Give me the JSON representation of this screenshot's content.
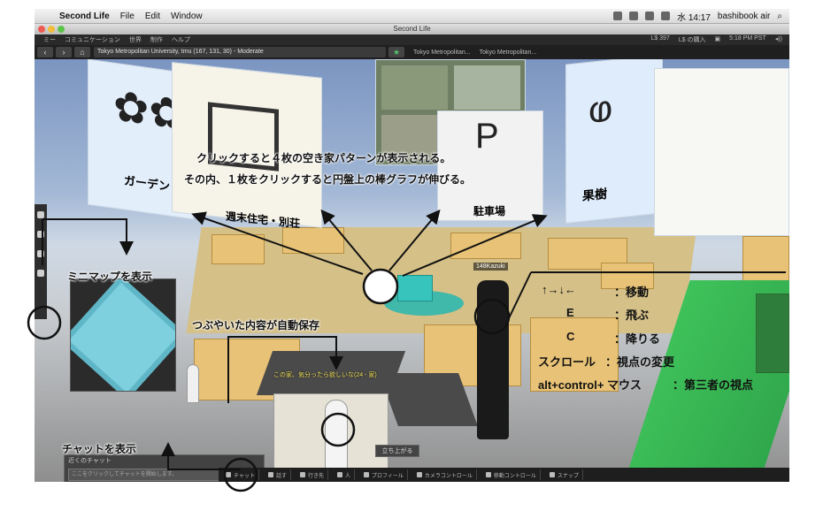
{
  "mac_menu": {
    "app": "Second Life",
    "items": [
      "File",
      "Edit",
      "Window"
    ],
    "clock": "水 14:17",
    "user": "bashibook air"
  },
  "window": {
    "title": "Second Life"
  },
  "sl_menu": {
    "items": [
      "ミー",
      "コミュニケーション",
      "世界",
      "制作",
      "ヘルプ"
    ],
    "balance": "L$ 397",
    "buy_label": "L$ の購入",
    "time": "5:18 PM PST"
  },
  "nav": {
    "address": "Tokyo Metropolitan University, tmu (167, 131, 30) - Moderate",
    "favorites": [
      "Tokyo Metropolitan...",
      "Tokyo Metropolitan..."
    ]
  },
  "scene": {
    "sign_weekend": "週末住宅・別荘",
    "sign_parking": "駐車場",
    "sign_garden": "ガーデン",
    "sign_orchard": "果樹",
    "sign_p": "P",
    "avatar_name": "148Kazuki",
    "chat_bubble": "この家、気分ったら欲しいな(24 - 家)",
    "sit_button": "立ち上がる"
  },
  "chat": {
    "header": "近くのチャット",
    "placeholder": "ここをクリックしてチャットを開始します。"
  },
  "bottom_bar": {
    "items": [
      "チャット",
      "話す",
      "行き先",
      "人",
      "プロフィール",
      "カメラコントロール",
      "移動コントロール",
      "スナップ"
    ]
  },
  "annotations": {
    "line1": "クリックすると４枚の空き家パターンが表示される。",
    "line2": "その内、１枚をクリックすると円盤上の棒グラフが伸びる。",
    "minimap": "ミニマップを表示",
    "autosave": "つぶやいた内容が自動保存",
    "chat": "チャットを表示"
  },
  "controls": {
    "move_keys": "↑→↓←",
    "move_desc": "：移動",
    "fly_key": "E",
    "fly_desc": "：飛ぶ",
    "land_key": "C",
    "land_desc": "：降りる",
    "scroll_key": "スクロール",
    "scroll_desc": "：視点の変更",
    "third_key": "alt+control+ マウス",
    "third_desc": "：第三者の視点"
  }
}
